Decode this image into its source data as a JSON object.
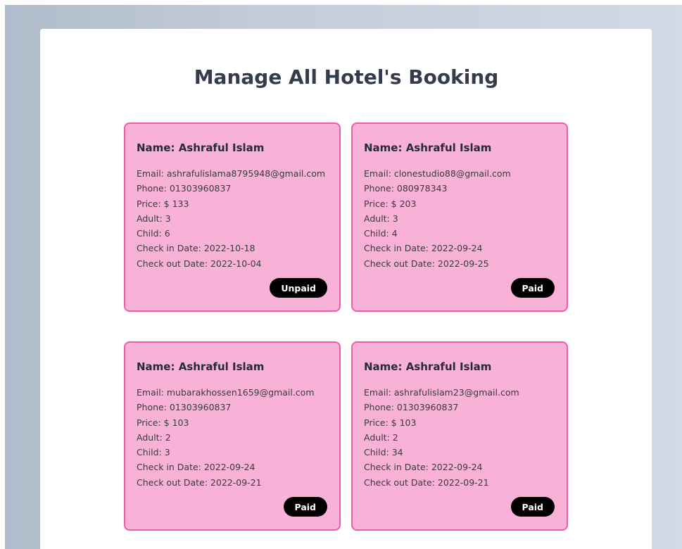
{
  "page": {
    "title": "Manage All Hotel's Booking"
  },
  "bookings": [
    {
      "name": "Name: Ashraful Islam",
      "email": "Email: ashrafulislama8795948@gmail.com",
      "phone": "Phone: 01303960837",
      "price": "Price: $ 133",
      "adult": "Adult: 3",
      "child": "Child: 6",
      "checkin": "Check in Date: 2022-10-18",
      "checkout": "Check out Date: 2022-10-04",
      "status": "Unpaid"
    },
    {
      "name": "Name: Ashraful Islam",
      "email": "Email: clonestudio88@gmail.com",
      "phone": "Phone: 080978343",
      "price": "Price: $ 203",
      "adult": "Adult: 3",
      "child": "Child: 4",
      "checkin": "Check in Date: 2022-09-24",
      "checkout": "Check out Date: 2022-09-25",
      "status": "Paid"
    },
    {
      "name": "Name: Ashraful Islam",
      "email": "Email: mubarakhossen1659@gmail.com",
      "phone": "Phone: 01303960837",
      "price": "Price: $ 103",
      "adult": "Adult: 2",
      "child": "Child: 3",
      "checkin": "Check in Date: 2022-09-24",
      "checkout": "Check out Date: 2022-09-21",
      "status": "Paid"
    },
    {
      "name": "Name: Ashraful Islam",
      "email": "Email: ashrafulislam23@gmail.com",
      "phone": "Phone: 01303960837",
      "price": "Price: $ 103",
      "adult": "Adult: 2",
      "child": "Child: 34",
      "checkin": "Check in Date: 2022-09-24",
      "checkout": "Check out Date: 2022-09-21",
      "status": "Paid"
    }
  ]
}
